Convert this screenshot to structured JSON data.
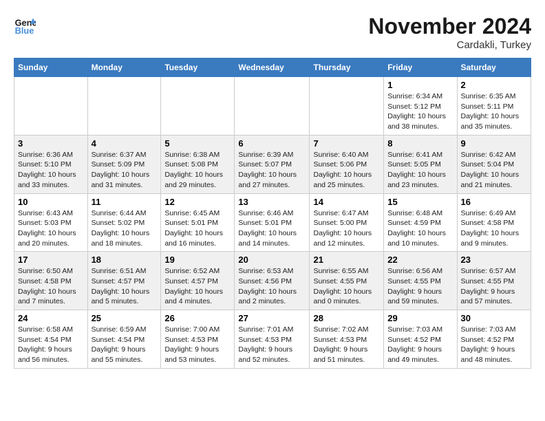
{
  "header": {
    "logo_line1": "General",
    "logo_line2": "Blue",
    "month": "November 2024",
    "location": "Cardakli, Turkey"
  },
  "columns": [
    "Sunday",
    "Monday",
    "Tuesday",
    "Wednesday",
    "Thursday",
    "Friday",
    "Saturday"
  ],
  "weeks": [
    [
      {
        "day": "",
        "content": ""
      },
      {
        "day": "",
        "content": ""
      },
      {
        "day": "",
        "content": ""
      },
      {
        "day": "",
        "content": ""
      },
      {
        "day": "",
        "content": ""
      },
      {
        "day": "1",
        "content": "Sunrise: 6:34 AM\nSunset: 5:12 PM\nDaylight: 10 hours and 38 minutes."
      },
      {
        "day": "2",
        "content": "Sunrise: 6:35 AM\nSunset: 5:11 PM\nDaylight: 10 hours and 35 minutes."
      }
    ],
    [
      {
        "day": "3",
        "content": "Sunrise: 6:36 AM\nSunset: 5:10 PM\nDaylight: 10 hours and 33 minutes."
      },
      {
        "day": "4",
        "content": "Sunrise: 6:37 AM\nSunset: 5:09 PM\nDaylight: 10 hours and 31 minutes."
      },
      {
        "day": "5",
        "content": "Sunrise: 6:38 AM\nSunset: 5:08 PM\nDaylight: 10 hours and 29 minutes."
      },
      {
        "day": "6",
        "content": "Sunrise: 6:39 AM\nSunset: 5:07 PM\nDaylight: 10 hours and 27 minutes."
      },
      {
        "day": "7",
        "content": "Sunrise: 6:40 AM\nSunset: 5:06 PM\nDaylight: 10 hours and 25 minutes."
      },
      {
        "day": "8",
        "content": "Sunrise: 6:41 AM\nSunset: 5:05 PM\nDaylight: 10 hours and 23 minutes."
      },
      {
        "day": "9",
        "content": "Sunrise: 6:42 AM\nSunset: 5:04 PM\nDaylight: 10 hours and 21 minutes."
      }
    ],
    [
      {
        "day": "10",
        "content": "Sunrise: 6:43 AM\nSunset: 5:03 PM\nDaylight: 10 hours and 20 minutes."
      },
      {
        "day": "11",
        "content": "Sunrise: 6:44 AM\nSunset: 5:02 PM\nDaylight: 10 hours and 18 minutes."
      },
      {
        "day": "12",
        "content": "Sunrise: 6:45 AM\nSunset: 5:01 PM\nDaylight: 10 hours and 16 minutes."
      },
      {
        "day": "13",
        "content": "Sunrise: 6:46 AM\nSunset: 5:01 PM\nDaylight: 10 hours and 14 minutes."
      },
      {
        "day": "14",
        "content": "Sunrise: 6:47 AM\nSunset: 5:00 PM\nDaylight: 10 hours and 12 minutes."
      },
      {
        "day": "15",
        "content": "Sunrise: 6:48 AM\nSunset: 4:59 PM\nDaylight: 10 hours and 10 minutes."
      },
      {
        "day": "16",
        "content": "Sunrise: 6:49 AM\nSunset: 4:58 PM\nDaylight: 10 hours and 9 minutes."
      }
    ],
    [
      {
        "day": "17",
        "content": "Sunrise: 6:50 AM\nSunset: 4:58 PM\nDaylight: 10 hours and 7 minutes."
      },
      {
        "day": "18",
        "content": "Sunrise: 6:51 AM\nSunset: 4:57 PM\nDaylight: 10 hours and 5 minutes."
      },
      {
        "day": "19",
        "content": "Sunrise: 6:52 AM\nSunset: 4:57 PM\nDaylight: 10 hours and 4 minutes."
      },
      {
        "day": "20",
        "content": "Sunrise: 6:53 AM\nSunset: 4:56 PM\nDaylight: 10 hours and 2 minutes."
      },
      {
        "day": "21",
        "content": "Sunrise: 6:55 AM\nSunset: 4:55 PM\nDaylight: 10 hours and 0 minutes."
      },
      {
        "day": "22",
        "content": "Sunrise: 6:56 AM\nSunset: 4:55 PM\nDaylight: 9 hours and 59 minutes."
      },
      {
        "day": "23",
        "content": "Sunrise: 6:57 AM\nSunset: 4:55 PM\nDaylight: 9 hours and 57 minutes."
      }
    ],
    [
      {
        "day": "24",
        "content": "Sunrise: 6:58 AM\nSunset: 4:54 PM\nDaylight: 9 hours and 56 minutes."
      },
      {
        "day": "25",
        "content": "Sunrise: 6:59 AM\nSunset: 4:54 PM\nDaylight: 9 hours and 55 minutes."
      },
      {
        "day": "26",
        "content": "Sunrise: 7:00 AM\nSunset: 4:53 PM\nDaylight: 9 hours and 53 minutes."
      },
      {
        "day": "27",
        "content": "Sunrise: 7:01 AM\nSunset: 4:53 PM\nDaylight: 9 hours and 52 minutes."
      },
      {
        "day": "28",
        "content": "Sunrise: 7:02 AM\nSunset: 4:53 PM\nDaylight: 9 hours and 51 minutes."
      },
      {
        "day": "29",
        "content": "Sunrise: 7:03 AM\nSunset: 4:52 PM\nDaylight: 9 hours and 49 minutes."
      },
      {
        "day": "30",
        "content": "Sunrise: 7:03 AM\nSunset: 4:52 PM\nDaylight: 9 hours and 48 minutes."
      }
    ]
  ]
}
